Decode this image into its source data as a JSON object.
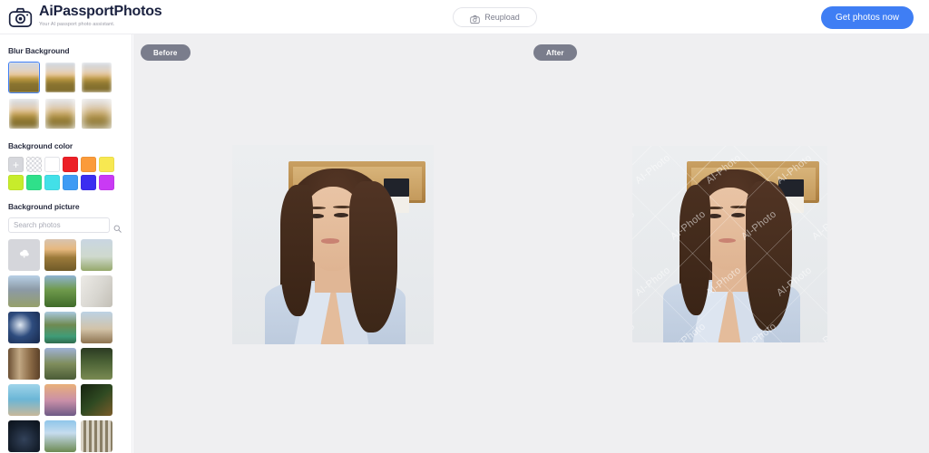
{
  "header": {
    "brand_name": "AiPassportPhotos",
    "brand_tagline": "Your AI passport photo assistant.",
    "brand_icon": "camera-icon",
    "reupload_label": "Reupload",
    "reupload_icon": "camera-refresh-icon",
    "cta_label": "Get photos now",
    "cta_color": "#3f7ef4"
  },
  "sidebar": {
    "blur": {
      "title": "Blur Background",
      "selected_index": 0,
      "options": [
        {
          "name": "blur-level-1"
        },
        {
          "name": "blur-level-2"
        },
        {
          "name": "blur-level-3"
        },
        {
          "name": "blur-level-4"
        },
        {
          "name": "blur-level-5"
        },
        {
          "name": "blur-level-6"
        }
      ]
    },
    "color": {
      "title": "Background color",
      "add_label": "+",
      "swatches": [
        {
          "name": "add-color",
          "value": "#d6d7dc"
        },
        {
          "name": "transparent",
          "value": "transparent"
        },
        {
          "name": "white",
          "value": "#ffffff"
        },
        {
          "name": "red",
          "value": "#ec2027"
        },
        {
          "name": "orange",
          "value": "#fb9b3a"
        },
        {
          "name": "yellow",
          "value": "#f7e851"
        },
        {
          "name": "lime",
          "value": "#c7ec2b"
        },
        {
          "name": "green",
          "value": "#2fe08a"
        },
        {
          "name": "cyan",
          "value": "#42e0e8"
        },
        {
          "name": "blue",
          "value": "#3f9bf4"
        },
        {
          "name": "indigo",
          "value": "#3b2ef0"
        },
        {
          "name": "magenta",
          "value": "#c93af4"
        }
      ]
    },
    "picture": {
      "title": "Background picture",
      "search_placeholder": "Search photos",
      "search_value": "",
      "search_icon": "search-icon",
      "upload_icon": "cloud-upload-icon",
      "thumbnails": [
        {
          "name": "upload-photo"
        },
        {
          "name": "photo-golden-field"
        },
        {
          "name": "photo-lone-tree"
        },
        {
          "name": "photo-mountain-peak"
        },
        {
          "name": "photo-green-hills"
        },
        {
          "name": "photo-white-interior"
        },
        {
          "name": "photo-blue-moon"
        },
        {
          "name": "photo-green-car"
        },
        {
          "name": "photo-desert-plain"
        },
        {
          "name": "photo-wood-door"
        },
        {
          "name": "photo-hilltop-castle"
        },
        {
          "name": "photo-tree-shade"
        },
        {
          "name": "photo-beach-pier"
        },
        {
          "name": "photo-flower-sunset"
        },
        {
          "name": "photo-dark-foliage"
        },
        {
          "name": "photo-night-sky"
        },
        {
          "name": "photo-cloud-park"
        },
        {
          "name": "photo-birch-forest"
        }
      ]
    }
  },
  "canvas": {
    "before_label": "Before",
    "after_label": "After",
    "watermark_text": "AI-Photo",
    "background": "#efeff1"
  }
}
